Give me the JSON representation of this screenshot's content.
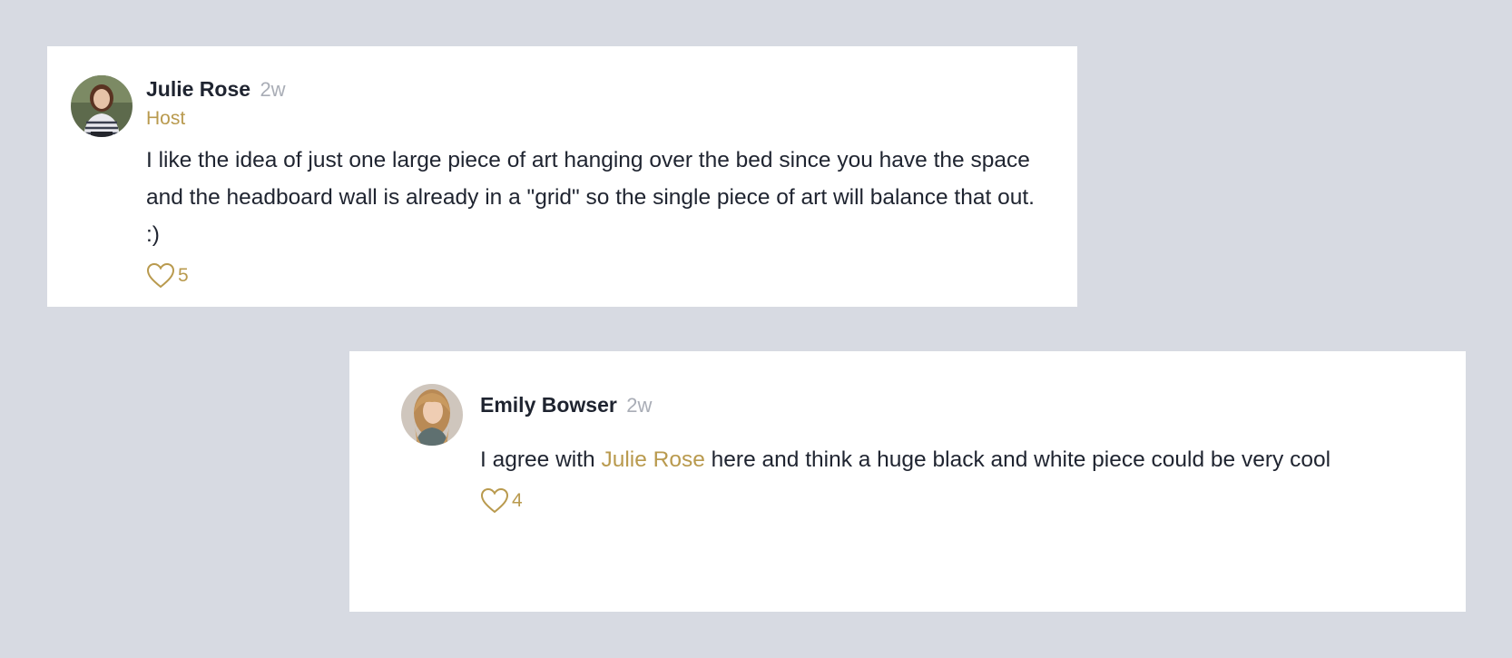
{
  "comments": [
    {
      "author": "Julie Rose",
      "time": "2w",
      "role": "Host",
      "body": "I like the idea of just one large piece of art hanging over the bed since you have the space and the headboard wall is already in a \"grid\" so the single piece of art will balance that out. :)",
      "likes": "5",
      "avatar_icon": "person-avatar-icon",
      "like_icon": "heart-outline-icon"
    },
    {
      "author": "Emily Bowser",
      "time": "2w",
      "body_prefix": "I agree with ",
      "mention": "Julie Rose",
      "body_suffix": " here and think a huge black and white piece could be very cool",
      "likes": "4",
      "avatar_icon": "person-avatar-icon",
      "like_icon": "heart-outline-icon"
    }
  ],
  "colors": {
    "background": "#d7dae2",
    "card": "#ffffff",
    "accent_gold": "#b99a4e",
    "text": "#1f2430",
    "muted": "#a9adb6"
  }
}
